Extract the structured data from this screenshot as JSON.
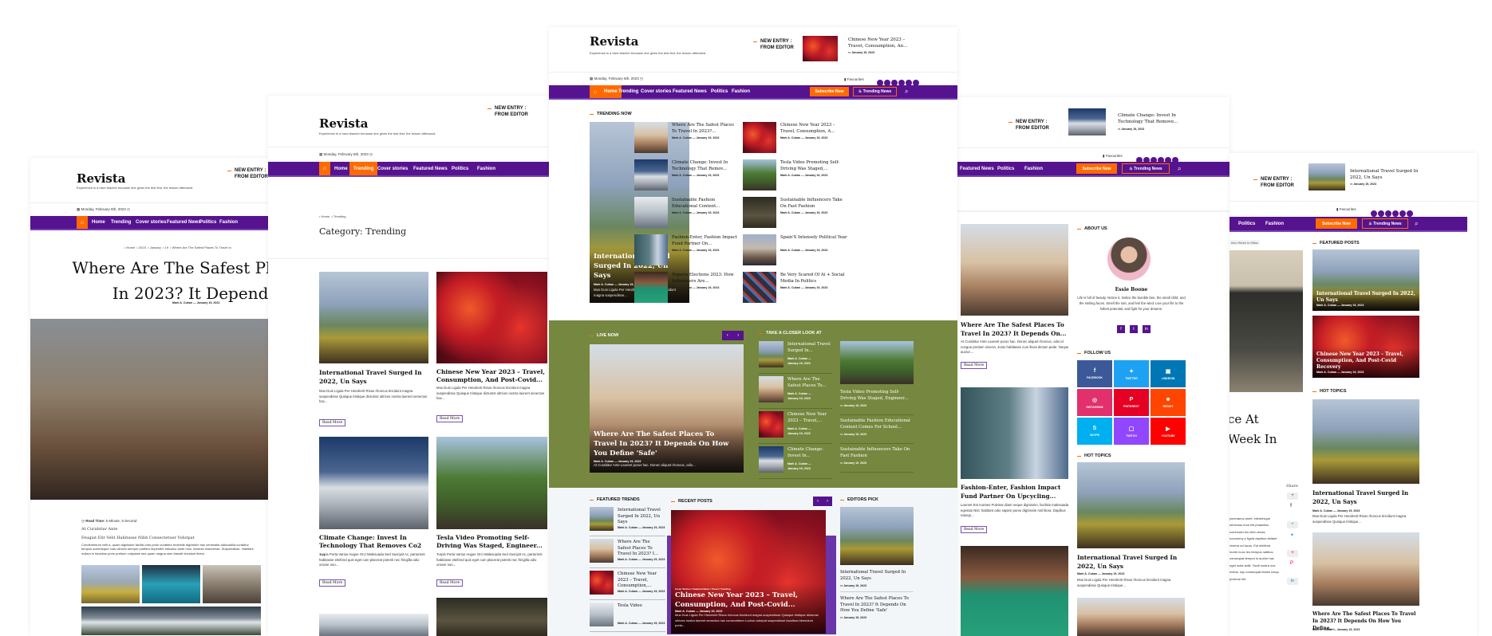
{
  "brand": {
    "name": "Revista",
    "tagline": "Experience is a hard teacher because she gives the test first, the lesson afterward.",
    "date": "Monday, February 6th, 2023",
    "new_entry": "NEW ENTRY :",
    "from_editor": "FROM EDITOR",
    "favourites": "Favourites",
    "subscribe": "Subscribe Now",
    "trending_news": "Trending News"
  },
  "nav": [
    "Home",
    "Trending",
    "Cover stories",
    "Featured News",
    "Politics",
    "Fashion"
  ],
  "colors": {
    "nav_purple": "#56138f",
    "accent_orange": "#ff6a00",
    "live_olive": "#76873f",
    "light_bg": "#f3f6f9"
  },
  "icons": {
    "home": "home-icon",
    "search": "search-icon",
    "calendar": "calendar-icon",
    "bookmark": "bookmark-icon",
    "fire": "fire-icon",
    "clock": "clock-icon"
  },
  "common": {
    "author": "Mark A. Cuban",
    "date": "January 19, 2023",
    "byline": "Mark A. Cuban — January 19, 2023",
    "read_more": "Read More"
  },
  "panel_single": {
    "breadcrumb": [
      "Home",
      "2023",
      "January",
      "19",
      "Where Are The Safest Places To Travel In"
    ],
    "title": "Where Are The Safest Places To Travel In 2023? It Depends On How",
    "read_time_label": "Read Time:",
    "read_time_value": "5 Minute, 9 Second",
    "subhead1": "At Curabitur Ante",
    "subhead2": "Feugiat Elit Velit Habitasse Nibh Consectetuer Volutpat",
    "body": "Condimentum velit a, quam dignissim facilisi cras proin curabitur molestie dignissim hac venenatis adiscubilia curabitur tempus scelerisque cras ultrices semper porttitor imperdiet ridiculus amet mus. Aenean maecenas. Suspendisse. Habitant nullam in faucibus proin pretium vulputate sed quam magna sem blandit tincidunt libero"
  },
  "panel_category": {
    "breadcrumb": [
      "Home",
      "Trending"
    ],
    "title": "Category: Trending",
    "cards": [
      {
        "title": "International Travel Surged In 2022, Un Says",
        "excerpt": "Mus Duis Ligula Per Hendrerit Risus rhoncus tincidunt magna suspendisse Quisque tristique dictumst ultrices nostra laoreet senectus hac..."
      },
      {
        "title": "Chinese New Year 2023 – Travel, Consumption, And Post-Covid...",
        "excerpt": "Mus Duis Ligula Per Hendrerit Risus rhoncus tincidunt magna suspendisse Quisque tristique dictumst ultrices nostra laoreet senectus hac..."
      },
      {
        "title": "Climate Change: Invest In Technology That Removes Co2 ...",
        "excerpt": "Turpis Porta Varius Augue Orci Malesuada Sed Suscipit Ac, parturient habitasse eleifend quis eget cum placerat potenti nec fringilla odio ornare nun..."
      },
      {
        "title": "Tesla Video Promoting Self-Driving Was Staged, Engineer...",
        "excerpt": "Turpis Porta Varius Augue Orci Malesuada Sed Suscipit Ac, parturient habitasse eleifend quis eget cum placerat potenti nec fringilla odio ornare nun..."
      }
    ]
  },
  "panel_home": {
    "header_entry": "Chinese New Year 2023 – Travel, Consumption, An...",
    "trending_heading": "TRENDING NOW",
    "trending_main": {
      "title": "International Travel Surged In 2022, Un Says",
      "excerpt": "Mus Duis Ligula Per Hendrerit Risus rhoncus tincidunt magna suspendisse..."
    },
    "trending_col1": [
      "Where Are The Safest Places To Travel In 2023?...",
      "Climate Change: Invest In Technology That Remov...",
      "Sustainable Fashion Educational Content...",
      "Fashion-Enter, Fashion Impact Fund Partner On...",
      "Nigeria Elections 2023: How Influencers Are..."
    ],
    "trending_col2": [
      "Chinese New Year 2023 – Travel, Consumption, A...",
      "Tesla Video Promoting Self-Driving Was Staged,...",
      "Sustainable Influencers Take On Fast Fashion",
      "Spain'S Intensely Political Year",
      "Be Very Scared Of Ai + Social Media In Politics"
    ],
    "live_heading": "LIVE NOW",
    "live_main": {
      "title": "Where Are The Safest Places To Travel In 2023? It Depends On How You Define 'Safe'",
      "excerpt": "At Curabitur Ante Laoreet purus hac. Donec aliquet rhoncus, odio..."
    },
    "closer_heading": "TAKE A CLOSER LOOK AT",
    "closer_list": [
      "International Travel Surged In...",
      "Where Are The Safest Places To...",
      "Chinese New Year 2023 – Travel,...",
      "Climate Change: Invest In..."
    ],
    "closer_right": [
      "Tesla Video Promoting Self-Driving Was Staged, Engineer...",
      "Sustainable Fashion Educational Content Comes For School...",
      "Sustainable Influencers Take On Fast Fashion"
    ],
    "featured_trends_heading": "FEATURED TRENDS",
    "featured_trends": [
      "International Travel Surged In 2022, Un Says",
      "Where Are The Safest Places To Travel In 2023? I...",
      "Chinese New Year 2023 – Travel, Consumption,...",
      "Tesla Video"
    ],
    "recent_heading": "RECENT POSTS",
    "recent_main": {
      "categories": "Cover Stories / Featured News / Travel / Trending",
      "title": "Chinese New Year 2023 – Travel, Consumption, And Post-Covid...",
      "excerpt": "Mus Duis Ligula Per Hendrerit Risus rhoncus tincidunt magna suspendisse Quisque tristique dictumst ultrices nostra laoreet senectus hac consectetuer Luctus volutpat suspendisse faucibus bibendum porta..."
    },
    "editors_heading": "EDITORS PICK",
    "editors": [
      "International Travel Surged In 2022, Un Says",
      "Where Are The Safest Places To Travel In 2023? It Depends On How You Define 'Safe'"
    ]
  },
  "panel_sidebar": {
    "header_entry": "Climate Change: Invest In Technology That Remove...",
    "posts": [
      {
        "title": "Where Are The Safest Places To Travel In 2023? It Depends On...",
        "excerpt": "At Curabitur Ante Laoreet purus hac. Donec aliquet rhoncus, odio id congue pretium viverra. Justo habitasse cum litora dictum pede. Neque auctor...."
      },
      {
        "title": "Fashion-Enter, Fashion Impact Fund Partner On Upcycling...",
        "excerpt": "Laoreet Est montes Pulvinar diam neque dignissim, facilisis malesuada egestas Nisl, habitant odio sapien purus dignissim nisl litora. Dapibus natoqu..."
      }
    ],
    "about_heading": "ABOUT US",
    "about_name": "Essie Boone",
    "about_bio": "Life is full of beauty. Notice it. Notice the bumble bee, the small child, and the smiling faces. Smell the rain, and feel the wind. Live your life to the fullest potential, and fight for your dreams.",
    "follow_heading": "FOLLOW US",
    "follow": [
      "FACEBOOK",
      "TWITTER",
      "LINKEDIN",
      "INSTAGRAM",
      "PINTEREST",
      "REDDIT",
      "SKYPE",
      "TWITCH",
      "YOUTUBE"
    ],
    "follow_colors": [
      "#3b5998",
      "#1da1f2",
      "#0077b5",
      "#e1306c",
      "#e60023",
      "#ff4500",
      "#00aff0",
      "#9146ff",
      "#ff0000"
    ],
    "hot_heading": "HOT TOPICS",
    "hot": {
      "title": "International Travel Surged In 2022, Un Says",
      "excerpt": "Mus Duis Ligula Per Hendrerit Risus rhoncus tincidunt magna suspendisse Quisque tristique..."
    }
  },
  "panel_article": {
    "header_entry": "International Travel Surged In 2022, Un Says",
    "tag": "hion Week In Milan",
    "title_fragment": "ce At Week In",
    "share_label": "Share",
    "body": "ymenaeos amet. ellentesque senectus mod elit phasellus commodo leo nibh cenas nonummy y ligula dapibus abitant viverra od lacus. Est eleifend morbi nunc leo tempus natibus consequat tempor is auctor hac eget nulla acilit. Taciti nostra ous metus. squ consequat fames losqu pulvinar elit",
    "featured_heading": "FEATURED POSTS",
    "featured": [
      "International Travel Surged In 2022, Un Says",
      "Chinese New Year 2023 – Travel, Consumption, And Post-Covid Recovery"
    ],
    "hot_heading": "HOT TOPICS",
    "hot": [
      {
        "title": "International Travel Surged In 2022, Un Says",
        "excerpt": "Mus Duis Ligula Per Hendrerit Risus rhoncus tincidunt magna suspendisse Quisque tristique..."
      },
      {
        "title": "Where Are The Safest Places To Travel In 2023? It Depends On How You Define..."
      }
    ]
  }
}
